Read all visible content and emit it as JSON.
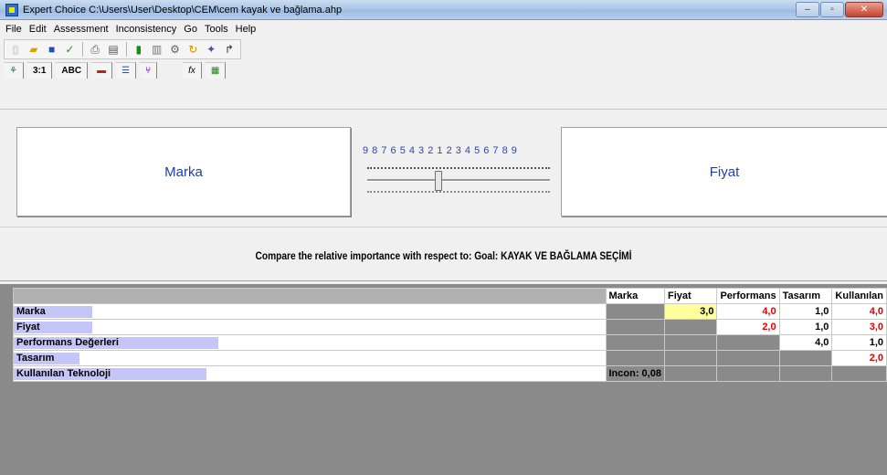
{
  "window": {
    "title": "Expert Choice    C:\\Users\\User\\Desktop\\CEM\\cem kayak ve bağlama.ahp",
    "controls": {
      "minimize": "–",
      "maximize": "▫",
      "close": "✕"
    }
  },
  "menu": [
    "File",
    "Edit",
    "Assessment",
    "Inconsistency",
    "Go",
    "Tools",
    "Help"
  ],
  "toolbar": {
    "icons": [
      "new-file-icon",
      "open-folder-icon",
      "save-icon",
      "check-icon",
      "print-icon",
      "print-preview-icon",
      "calculator-icon",
      "chart-icon",
      "settings-icon",
      "refresh-icon",
      "wand-icon",
      "arrow-icon"
    ]
  },
  "mode_tabs": {
    "numerical": "3:1",
    "verbal": "ABC",
    "formula": "fx"
  },
  "comparison": {
    "left": "Marka",
    "right": "Fiyat",
    "scale": "9 8 7 6 5 4 3 2 1 2 3 4 5 6 7 8 9",
    "value": 3
  },
  "prompt": "Compare the relative importance with respect to: Goal: KAYAK VE BAĞLAMA SEÇİMİ",
  "matrix": {
    "columns": [
      "Marka",
      "Fiyat",
      "Performans",
      "Tasarım",
      "Kullanılan"
    ],
    "rows": [
      {
        "name": "Marka",
        "bar": 0.13,
        "cells": [
          "",
          "3,0",
          "4,0",
          "1,0",
          "4,0"
        ]
      },
      {
        "name": "Fiyat",
        "bar": 0.13,
        "cells": [
          "",
          "",
          "2,0",
          "1,0",
          "3,0"
        ]
      },
      {
        "name": "Performans Değerleri",
        "bar": 0.34,
        "cells": [
          "",
          "",
          "",
          "4,0",
          "1,0"
        ]
      },
      {
        "name": "Tasarım",
        "bar": 0.11,
        "cells": [
          "",
          "",
          "",
          "",
          "2,0"
        ]
      },
      {
        "name": "Kullanılan Teknoloji",
        "bar": 0.32,
        "cells": [
          "",
          "",
          "",
          "",
          ""
        ]
      }
    ],
    "inconsistency": "Incon: 0,08"
  }
}
